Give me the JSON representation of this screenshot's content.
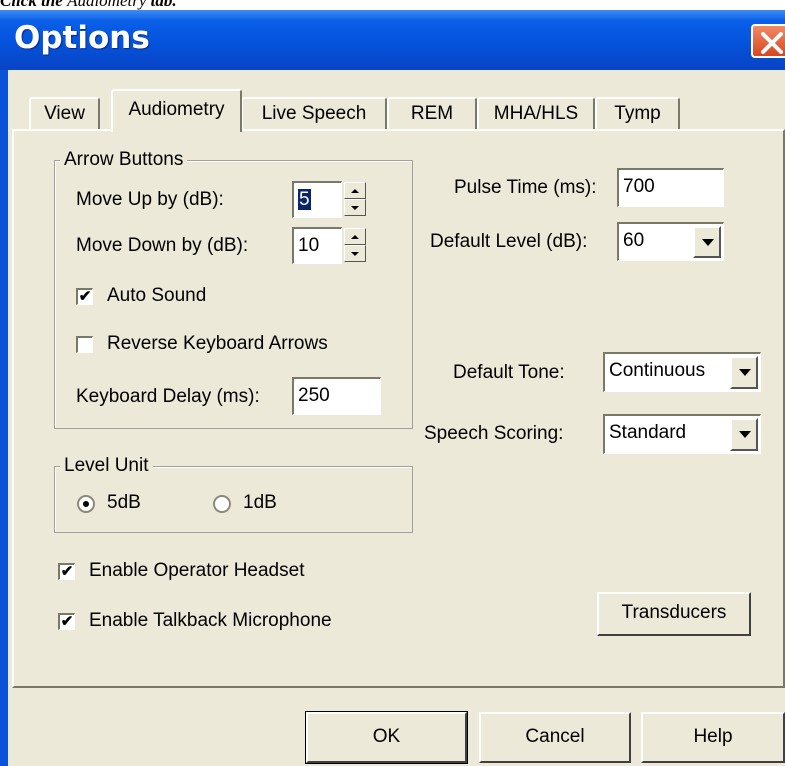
{
  "caption": {
    "prefix": "Click the ",
    "emph": "Audiometry",
    "suffix": " tab."
  },
  "window": {
    "title": "Options",
    "close_symbol": "✕"
  },
  "tabs": [
    {
      "label": "View",
      "active": false
    },
    {
      "label": "Audiometry",
      "active": true
    },
    {
      "label": "Live Speech",
      "active": false
    },
    {
      "label": "REM",
      "active": false
    },
    {
      "label": "MHA/HLS",
      "active": false
    },
    {
      "label": "Tymp",
      "active": false
    }
  ],
  "arrow_buttons": {
    "legend": "Arrow Buttons",
    "move_up_label": "Move Up by (dB):",
    "move_up_value": "5",
    "move_down_label": "Move Down by (dB):",
    "move_down_value": "10",
    "auto_sound_label": "Auto Sound",
    "auto_sound_checked": true,
    "reverse_label": "Reverse Keyboard Arrows",
    "reverse_checked": false,
    "keyboard_delay_label": "Keyboard Delay (ms):",
    "keyboard_delay_value": "250"
  },
  "level_unit": {
    "legend": "Level Unit",
    "options": [
      {
        "label": "5dB",
        "selected": true
      },
      {
        "label": "1dB",
        "selected": false
      }
    ]
  },
  "right": {
    "pulse_time_label": "Pulse Time (ms):",
    "pulse_time_value": "700",
    "default_level_label": "Default Level (dB):",
    "default_level_value": "60",
    "default_tone_label": "Default Tone:",
    "default_tone_value": "Continuous",
    "speech_scoring_label": "Speech Scoring:",
    "speech_scoring_value": "Standard"
  },
  "checks": {
    "operator_headset_label": "Enable Operator Headset",
    "operator_headset_checked": true,
    "talkback_label": "Enable Talkback Microphone",
    "talkback_checked": true
  },
  "transducers_label": "Transducers",
  "footer": {
    "ok": "OK",
    "cancel": "Cancel",
    "help": "Help"
  },
  "check_mark": "✔",
  "colors": {
    "titlebar": "#0553dc",
    "face": "#ece9d8",
    "close": "#d8461e",
    "selection": "#0a246a"
  }
}
